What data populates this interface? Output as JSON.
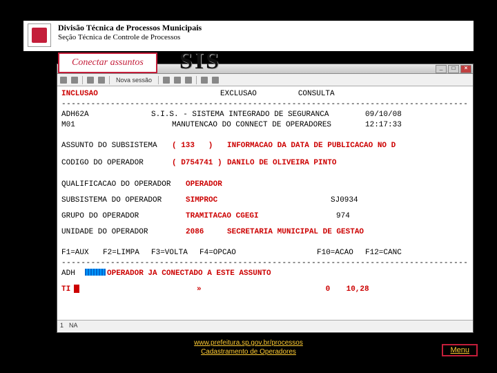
{
  "header": {
    "line1": "Divisão Técnica de Processos Municipais",
    "line2": "Seção Técnica de Controle de Processos"
  },
  "tab": {
    "label": "Conectar assuntos"
  },
  "sis_logo": "SIS",
  "window": {
    "toolbar": {
      "novasessao": "Nova sessão"
    },
    "topmenu": {
      "inclusao": "INCLUSAO",
      "exclusao": "EXCLUSAO",
      "consulta": "CONSULTA"
    },
    "hdr": {
      "code": "ADH62A",
      "title": "S.I.S. - SISTEMA INTEGRADO DE SEGURANCA",
      "date": "09/10/08",
      "m": "M01",
      "subtitle": "MANUTENCAO DO CONNECT DE OPERADORES",
      "time": "12:17:33"
    },
    "fields": {
      "assunto_lbl": "ASSUNTO DO SUBSISTEMA",
      "assunto_val": "( 133   )",
      "assunto_desc": "INFORMACAO DA DATA DE PUBLICACAO NO D",
      "codigo_lbl": "CODIGO DO OPERADOR",
      "codigo_val": "( D754741 )",
      "codigo_desc": "DANILO DE OLIVEIRA PINTO",
      "qualif_lbl": "QUALIFICACAO DO OPERADOR",
      "qualif_val": "OPERADOR",
      "subsis_lbl": "SUBSISTEMA DO OPERADOR",
      "subsis_val": "SIMPROC",
      "subsis_code": "SJ0934",
      "grupo_lbl": "GRUPO DO OPERADOR",
      "grupo_val": "TRAMITACAO CGEGI",
      "grupo_code": "974",
      "unidade_lbl": "UNIDADE DO OPERADOR",
      "unidade_val": "2086",
      "unidade_desc": "SECRETARIA MUNICIPAL DE GESTAO"
    },
    "fkeys": {
      "f1": "F1=AUX",
      "f2": "F2=LIMPA",
      "f3": "F3=VOLTA",
      "f4": "F4=OPCAO",
      "f10": "F10=ACAO",
      "f12": "F12=CANC"
    },
    "msg": {
      "prefix": "ADH",
      "text": "OPERADOR JA CONECTADO A ESTE ASSUNTO"
    },
    "bottom": {
      "ti": "TI",
      "arrow": "»",
      "zero": "0",
      "coords": "10,28"
    },
    "status": {
      "left": "1",
      "mid": "NA"
    }
  },
  "footer": {
    "link1": "www.prefeitura.sp.gov.br/processos",
    "link2": "Cadastramento de Operadores"
  },
  "menu": "Menu"
}
